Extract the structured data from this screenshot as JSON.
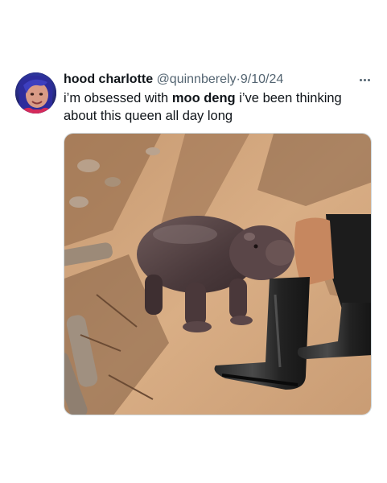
{
  "tweet": {
    "author": {
      "display_name": "hood charlotte",
      "handle": "@quinnberely",
      "avatar_icon": "profile-photo"
    },
    "separator": "·",
    "date": "9/10/24",
    "text": {
      "before": "i’m obsessed with ",
      "bold": "moo deng",
      "after": " i’ve been thinking about this queen all day long"
    },
    "more_icon": "more-options-icon",
    "media": {
      "alt": "photo of a baby pygmy hippo leaning against a person's leg wearing black rubber boots on dirt ground"
    }
  }
}
